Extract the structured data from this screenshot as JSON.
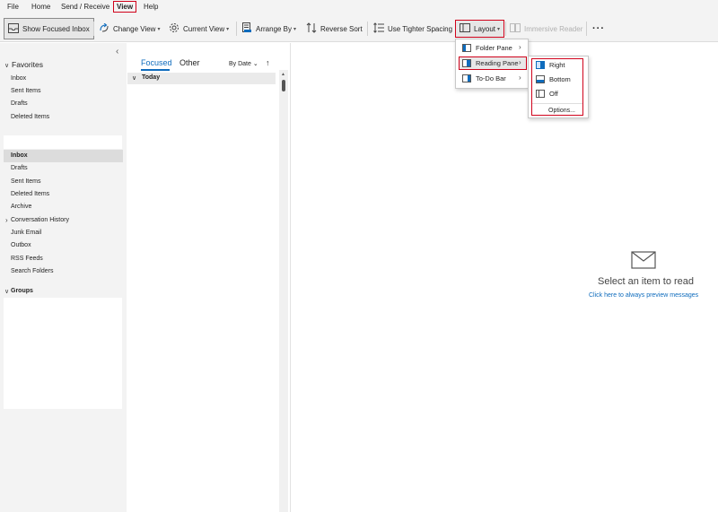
{
  "menubar": {
    "items": [
      "File",
      "Home",
      "Send / Receive",
      "View",
      "Help"
    ]
  },
  "ribbon": {
    "show_focused_inbox": "Show Focused Inbox",
    "change_view": "Change View",
    "current_view": "Current View",
    "arrange_by": "Arrange By",
    "reverse_sort": "Reverse Sort",
    "tighter_spacing": "Use Tighter Spacing",
    "layout": "Layout",
    "immersive_reader": "Immersive Reader",
    "more": "···"
  },
  "folder_pane": {
    "collapse": "‹",
    "favorites_header": "Favorites",
    "favorites": [
      "Inbox",
      "Sent Items",
      "Drafts",
      "Deleted Items"
    ],
    "folders": [
      "Inbox",
      "Drafts",
      "Sent Items",
      "Deleted Items",
      "Archive",
      "Conversation History",
      "Junk Email",
      "Outbox",
      "RSS Feeds",
      "Search Folders"
    ],
    "groups_header": "Groups"
  },
  "message_list": {
    "tab_focused": "Focused",
    "tab_other": "Other",
    "sort_label": "By Date",
    "sort_arrow": "↑",
    "group_today": "Today"
  },
  "reading_pane": {
    "empty_title": "Select an item to read",
    "empty_link": "Click here to always preview messages"
  },
  "layout_menu": {
    "items": [
      {
        "label": "Folder Pane",
        "key": "F"
      },
      {
        "label": "Reading Pane",
        "key": "R"
      },
      {
        "label": "To-Do Bar",
        "key": "T"
      }
    ]
  },
  "reading_pane_menu": {
    "items": [
      "Right",
      "Bottom",
      "Off"
    ],
    "options": "Options..."
  },
  "colors": {
    "accent": "#0f6cbd",
    "highlight_red": "#d0021b",
    "pane_bg": "#f3f3f3"
  }
}
